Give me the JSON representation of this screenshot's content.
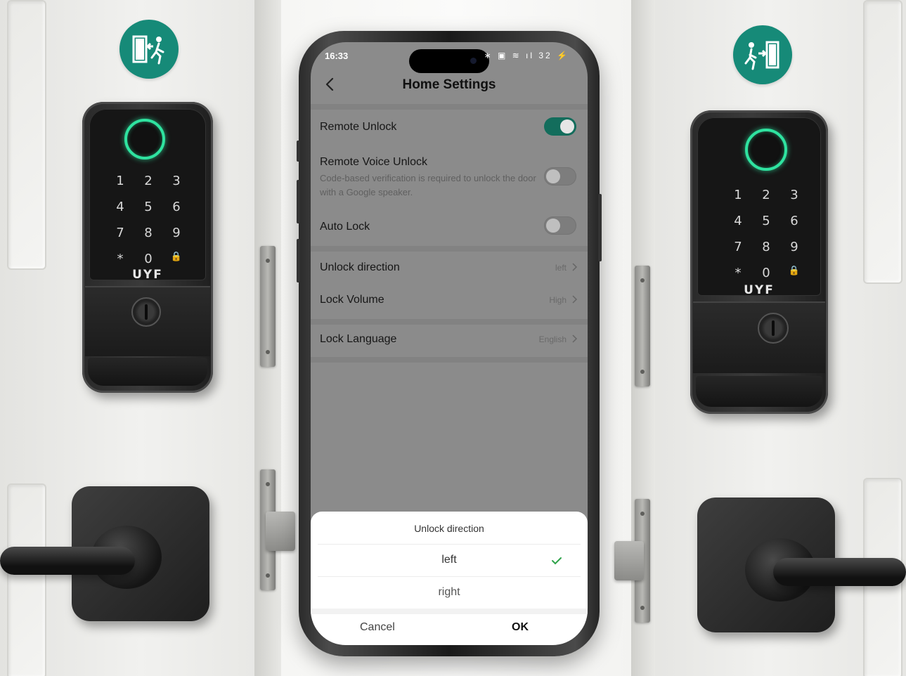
{
  "left_lock": {
    "keys": [
      "1",
      "2",
      "3",
      "4",
      "5",
      "6",
      "7",
      "8",
      "9",
      "*",
      "0",
      "🔒"
    ],
    "brand": "UYF"
  },
  "right_lock": {
    "keys": [
      "1",
      "2",
      "3",
      "4",
      "5",
      "6",
      "7",
      "8",
      "9",
      "*",
      "0",
      "🔒"
    ],
    "brand": "UYF"
  },
  "badges": {
    "left": "exit-door-icon",
    "right": "enter-door-icon",
    "color": "#168a78"
  },
  "phone": {
    "status": {
      "time": "16:33",
      "icons": "∗ ▣ ≋ ıl 32 ⚡"
    },
    "header": {
      "title": "Home Settings"
    },
    "settings": {
      "remote_unlock": {
        "label": "Remote Unlock",
        "enabled": true
      },
      "remote_voice_unlock": {
        "label": "Remote Voice Unlock",
        "description": "Code-based verification is required to unlock the door with a Google speaker.",
        "enabled": false
      },
      "auto_lock": {
        "label": "Auto Lock",
        "enabled": false
      },
      "unlock_direction": {
        "label": "Unlock direction",
        "value": "left"
      },
      "lock_volume": {
        "label": "Lock Volume",
        "value": "High"
      },
      "lock_language": {
        "label": "Lock Language",
        "value": "English"
      }
    },
    "sheet": {
      "title": "Unlock direction",
      "options": [
        "left",
        "right"
      ],
      "selected": "left",
      "cancel_label": "Cancel",
      "ok_label": "OK"
    },
    "colors": {
      "accent": "#136d5c",
      "check": "#2ea34a"
    }
  }
}
